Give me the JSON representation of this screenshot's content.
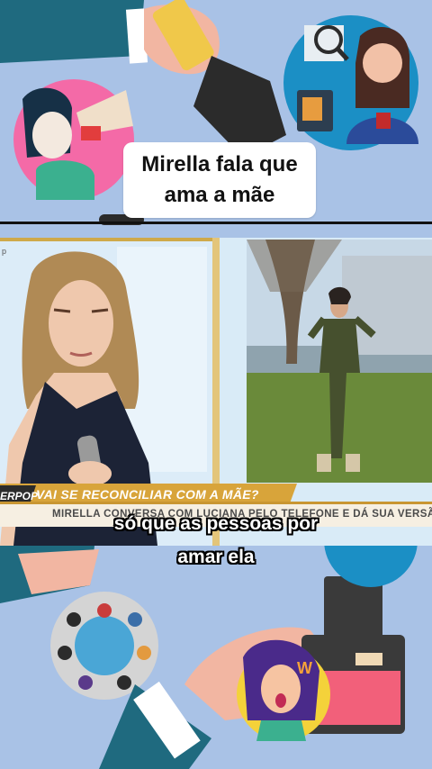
{
  "header_card": {
    "line1": "Mirella fala que",
    "line2": "ama a mãe"
  },
  "video": {
    "channel_tag": "p",
    "lower_third": {
      "logo": "ERPOP",
      "headline": "VAI SE RECONCILIAR COM A MÃE?",
      "subheadline": "MIRELLA CONVERSA COM LUCIANA PELO TELEFONE E DÁ SUA VERSÃO!"
    }
  },
  "captions": {
    "line1": "só que as pessoas por",
    "line2": "amar ela"
  },
  "colors": {
    "background": "#a9c2e6",
    "lower_third_gold": "#d8a43a",
    "caption_text": "#ffffff"
  }
}
